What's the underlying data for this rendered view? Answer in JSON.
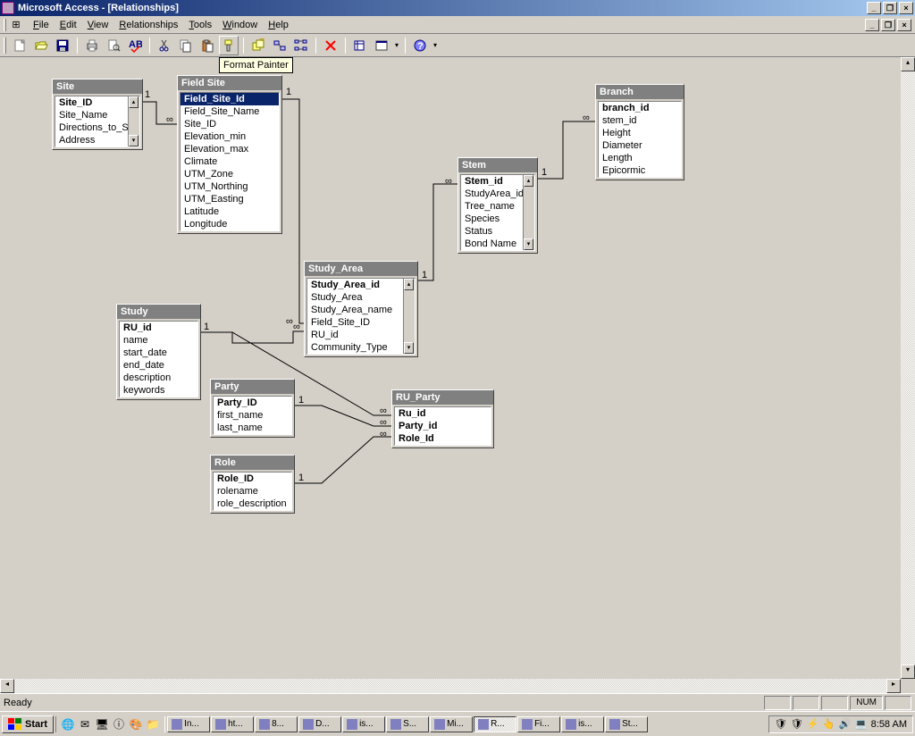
{
  "window_title": "Microsoft Access - [Relationships]",
  "menus": [
    "File",
    "Edit",
    "View",
    "Relationships",
    "Tools",
    "Window",
    "Help"
  ],
  "tooltip": "Format Painter",
  "status": {
    "ready": "Ready",
    "num": "NUM"
  },
  "tables": {
    "site": {
      "title": "Site",
      "fields": [
        "Site_ID",
        "Site_Name",
        "Directions_to_Si",
        "Address"
      ],
      "pk": [
        "Site_ID"
      ],
      "scroll": true
    },
    "field_site": {
      "title": "Field Site",
      "fields": [
        "Field_Site_Id",
        "Field_Site_Name",
        "Site_ID",
        "Elevation_min",
        "Elevation_max",
        "Climate",
        "UTM_Zone",
        "UTM_Northing",
        "UTM_Easting",
        "Latitude",
        "Longitude"
      ],
      "pk": [
        "Field_Site_Id"
      ],
      "selected": "Field_Site_Id"
    },
    "study_area": {
      "title": "Study_Area",
      "fields": [
        "Study_Area_id",
        "Study_Area",
        "Study_Area_name",
        "Field_Site_ID",
        "RU_id",
        "Community_Type"
      ],
      "pk": [
        "Study_Area_id"
      ],
      "scroll": true
    },
    "stem": {
      "title": "Stem",
      "fields": [
        "Stem_id",
        "StudyArea_id",
        "Tree_name",
        "Species",
        "Status",
        "Bond Name"
      ],
      "pk": [
        "Stem_id"
      ],
      "scroll": true
    },
    "branch": {
      "title": "Branch",
      "fields": [
        "branch_id",
        "stem_id",
        "Height",
        "Diameter",
        "Length",
        "Epicormic"
      ],
      "pk": [
        "branch_id"
      ]
    },
    "study": {
      "title": "Study",
      "fields": [
        "RU_id",
        "name",
        "start_date",
        "end_date",
        "description",
        "keywords"
      ],
      "pk": [
        "RU_id"
      ]
    },
    "party": {
      "title": "Party",
      "fields": [
        "Party_ID",
        "first_name",
        "last_name"
      ],
      "pk": [
        "Party_ID"
      ]
    },
    "role": {
      "title": "Role",
      "fields": [
        "Role_ID",
        "rolename",
        "role_description"
      ],
      "pk": [
        "Role_ID"
      ]
    },
    "ru_party": {
      "title": "RU_Party",
      "fields": [
        "Ru_id",
        "Party_id",
        "Role_Id"
      ],
      "pk": [
        "Ru_id",
        "Party_id",
        "Role_Id"
      ]
    }
  },
  "relationships": [
    {
      "from": "site",
      "to": "field_site",
      "one": "1",
      "many": "∞"
    },
    {
      "from": "field_site",
      "to": "study_area",
      "one": "1",
      "many": "∞"
    },
    {
      "from": "study_area",
      "to": "stem",
      "one": "1",
      "many": "∞"
    },
    {
      "from": "stem",
      "to": "branch",
      "one": "1",
      "many": "∞"
    },
    {
      "from": "study",
      "to": "study_area",
      "one": "1",
      "many": "∞"
    },
    {
      "from": "study",
      "to": "ru_party",
      "one": "1",
      "many": "∞"
    },
    {
      "from": "party",
      "to": "ru_party",
      "one": "1",
      "many": "∞"
    },
    {
      "from": "role",
      "to": "ru_party",
      "one": "1",
      "many": "∞"
    }
  ],
  "taskbar": {
    "start": "Start",
    "tasks": [
      "In...",
      "ht...",
      "8...",
      "D...",
      "is...",
      "S...",
      "Mi...",
      "R...",
      "Fi...",
      "is...",
      "St..."
    ],
    "active_task": 7,
    "time": "8:58 AM"
  }
}
